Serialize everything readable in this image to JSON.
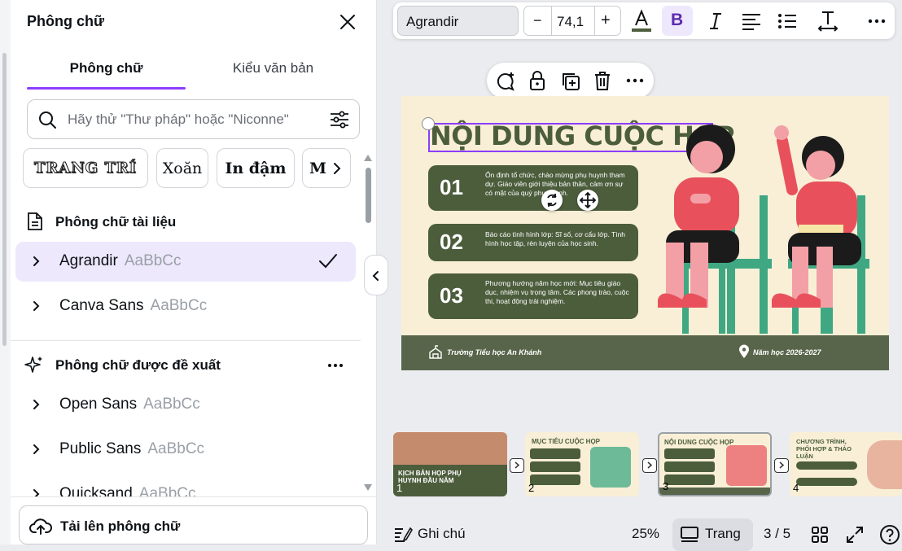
{
  "panel": {
    "title": "Phông chữ",
    "tabs": [
      "Phông chữ",
      "Kiểu văn bản"
    ],
    "search_placeholder": "Hãy thử \"Thư pháp\" hoặc \"Niconne\"",
    "chips": [
      "TRANG TRÍ",
      "Xoăn",
      "In đậm",
      "Mớ"
    ],
    "doc_fonts_title": "Phông chữ tài liệu",
    "doc_fonts": [
      {
        "name": "Agrandir",
        "sample": "AaBbCc"
      },
      {
        "name": "Canva Sans",
        "sample": "AaBbCc"
      }
    ],
    "suggested_title": "Phông chữ được đề xuất",
    "suggested_fonts": [
      {
        "name": "Open Sans",
        "sample": "AaBbCc"
      },
      {
        "name": "Public Sans",
        "sample": "AaBbCc"
      },
      {
        "name": "Quicksand",
        "sample": "AaBbCc"
      }
    ],
    "upload_label": "Tải lên phông chữ"
  },
  "toolbar": {
    "font": "Agrandir",
    "size": "74,1",
    "minus": "−",
    "plus": "+"
  },
  "slide": {
    "title": "NỘI DUNG CUỘC HỌP",
    "items": [
      {
        "num": "01",
        "text": "Ổn định tổ chức, chào mừng phụ huynh tham dự. Giáo viên giới thiệu bản thân, cảm ơn sự có mặt của quý phụ huynh."
      },
      {
        "num": "02",
        "text": "Báo cáo tình hình lớp: Sĩ số, cơ cấu lớp. Tình hình học tập, rèn luyện của học sinh."
      },
      {
        "num": "03",
        "text": "Phương hướng năm học mới: Mục tiêu giáo dục, nhiệm vụ trọng tâm. Các phong trào, cuộc thi, hoạt động trải nghiệm."
      }
    ],
    "school": "Trường Tiểu học An Khánh",
    "year": "Năm học 2026-2027"
  },
  "thumbnails": [
    {
      "num": "1",
      "title": "KỊCH BẢN HỌP PHỤ HUYNH ĐẦU NĂM"
    },
    {
      "num": "2",
      "title": "MỤC TIÊU CUỘC HỌP"
    },
    {
      "num": "3",
      "title": "NỘI DUNG CUỘC HỌP"
    },
    {
      "num": "4",
      "title": "CHƯƠNG TRÌNH, PHỐI HỢP & THẢO LUẬN"
    }
  ],
  "bottom": {
    "notes": "Ghi chú",
    "zoom": "25%",
    "page_view": "Trang",
    "page_count": "3 / 5"
  },
  "colors": {
    "accent": "#8b3dff",
    "selected_row": "#ede8fc",
    "slide_green": "#4c5d3c",
    "slide_bg": "#f8efd6"
  }
}
